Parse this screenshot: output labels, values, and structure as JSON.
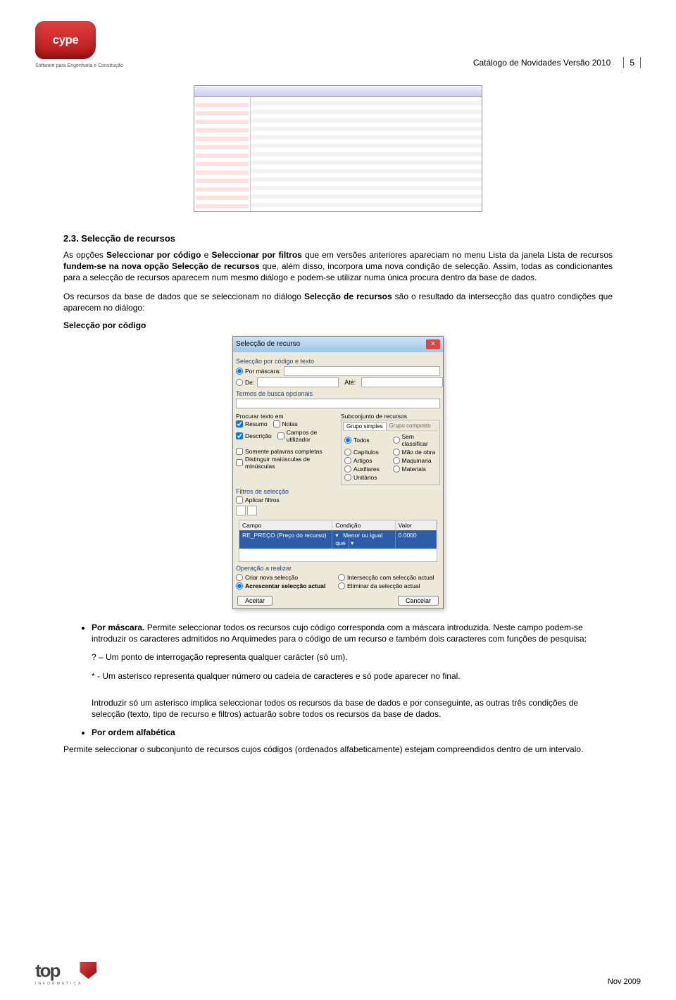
{
  "header": {
    "logo_text": "cype",
    "tagline": "Software para Engenharia e Construção",
    "doc_title": "Catálogo de Novidades Versão 2010",
    "page_num": "5"
  },
  "section": {
    "number_title": "2.3. Selecção de recursos",
    "para1_a": "As opções ",
    "para1_b1": "Seleccionar por código",
    "para1_c": " e ",
    "para1_b2": "Seleccionar por filtros",
    "para1_d": " que em versões anteriores apareciam no menu Lista da janela Lista de recursos ",
    "para1_b3": "fundem-se na nova opção Selecção de recursos",
    "para1_e": " que, além disso, incorpora uma nova condição de selecção. Assim, todas as condicionantes para a selecção de recursos aparecem num mesmo diálogo e podem-se utilizar numa única procura dentro da base de dados.",
    "para2_a": "Os recursos da base de dados que se seleccionam no diálogo ",
    "para2_b": "Selecção de recursos",
    "para2_c": " são o resultado da intersecção das quatro condições que aparecem no diálogo:",
    "sub_heading": "Selecção por código"
  },
  "dialog": {
    "title": "Selecção de recurso",
    "sel_label": "Selecção por código e texto",
    "por_mascara": "Por máscara:",
    "de": "De:",
    "ate": "Até:",
    "termos": "Termos de busca opcionais",
    "procurar": "Procurar texto em",
    "subconjunto": "Subconjunto de recursos",
    "resumo": "Resumo",
    "notas": "Notas",
    "descricao": "Descrição",
    "campos": "Campos de utilizador",
    "tab1": "Grupo simples",
    "tab2": "Grupo composto",
    "todos": "Todos",
    "sem": "Sem classificar",
    "capitulos": "Capítulos",
    "mao": "Mão de obra",
    "artigos": "Artigos",
    "maquinaria": "Maquinaria",
    "auxiliares": "Auxiliares",
    "materiais": "Materiais",
    "unitarios": "Unitários",
    "somente": "Somente palavras completas",
    "distinguir": "Distinguir maiúsculas de minúsculas",
    "filtros": "Filtros de selecção",
    "aplicar": "Aplicar filtros",
    "campo": "Campo",
    "condicao": "Condição",
    "valor": "Valor",
    "f_campo": "RE_PREÇO (Preço do recurso)",
    "f_cond": "Menor ou igual que",
    "f_val": "0.0000",
    "operacao": "Operação a realizar",
    "criar": "Criar nova selecção",
    "acrescentar": "Acrescentar selecção actual",
    "inter": "Intersecção com selecção actual",
    "eliminar": "Eliminar da selecção actual",
    "aceitar": "Aceitar",
    "cancelar": "Cancelar"
  },
  "bullets": {
    "b1_a": "Por máscara.",
    "b1_b": " Permite seleccionar todos os recursos cujo código corresponda com a máscara introduzida. Neste campo podem-se introduzir os caracteres admitidos no Arquimedes para o código de um recurso e também dois caracteres com funções de pesquisa:",
    "line_q": "? – Um ponto de interrogação representa qualquer carácter (só um).",
    "line_a": "* - Um asterisco representa qualquer número ou cadeia de caracteres e só pode aparecer no final.",
    "note": "Introduzir só um asterisco implica seleccionar todos os recursos da base de dados e por conseguinte, as outras três condições de selecção (texto, tipo de recurso e filtros) actuarão sobre todos os recursos da base de dados.",
    "b2_title": "Por ordem alfabética",
    "b2_text": "Permite seleccionar o subconjunto de recursos cujos códigos (ordenados alfabeticamente) estejam compreendidos dentro de um intervalo."
  },
  "footer": {
    "brand": "top",
    "brand_sub": "INFORMÁTICA",
    "date": "Nov 2009"
  }
}
